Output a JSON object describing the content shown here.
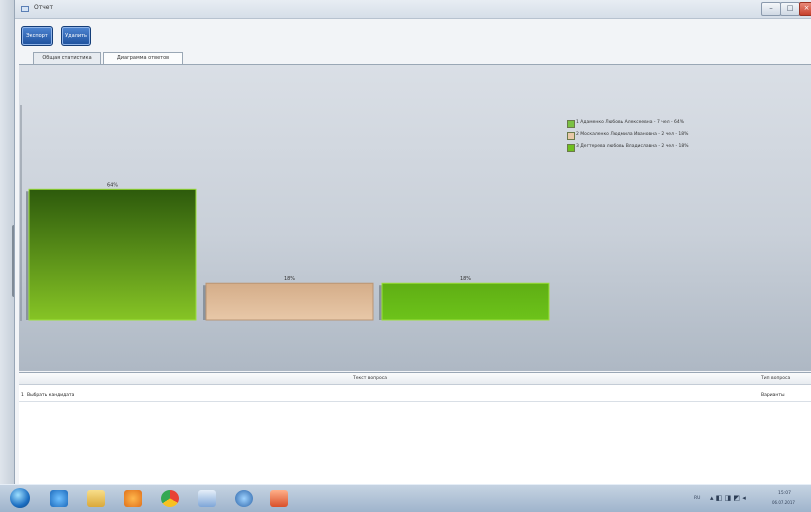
{
  "window": {
    "title": "Отчет"
  },
  "toolbar": {
    "export_label": "Экспорт",
    "delete_label": "Удалить"
  },
  "tabs": [
    {
      "label": "Общая статистика",
      "active": false
    },
    {
      "label": "Диаграмма ответов",
      "active": true
    }
  ],
  "chart_data": {
    "type": "bar",
    "categories": [
      "1 Адаменко Любовь Алексеевна - 7 чел - 64%",
      "2 Москаленко Людмила Ивановна - 2 чел - 18%",
      "3 Дегтерева любовь Владиславна - 2 чел - 18%"
    ],
    "values": [
      64,
      18,
      18
    ],
    "data_labels": [
      "64%",
      "18%",
      "18%"
    ],
    "colors": [
      "#5f9a16",
      "#dcb796",
      "#6fc414"
    ],
    "ylim": [
      0,
      100
    ],
    "legend": "top-right"
  },
  "legend": [
    {
      "label": "1 Адаменко Любовь Алексеевна - 7 чел - 64%",
      "color": "#7ac143"
    },
    {
      "label": "2 Москаленко Людмила Ивановна - 2 чел - 18%",
      "color": "#e8c9a8"
    },
    {
      "label": "3 Дегтерева любовь Владиславна - 2 чел - 18%",
      "color": "#6fbf1f"
    }
  ],
  "grid": {
    "columns": [
      "Текст вопроса",
      "Тип вопроса"
    ],
    "rows": [
      {
        "num": "1",
        "question": "Выбрать кандидата",
        "type": "Варианты"
      }
    ]
  },
  "tray": {
    "lang": "RU",
    "time": "15:07",
    "date": "06.07.2017"
  },
  "icons": {
    "start": "start-orb-icon",
    "apps": [
      "ie-icon",
      "folder-icon",
      "media-player-icon",
      "chrome-icon",
      "notepad-icon",
      "globe-icon",
      "presentation-icon"
    ]
  }
}
